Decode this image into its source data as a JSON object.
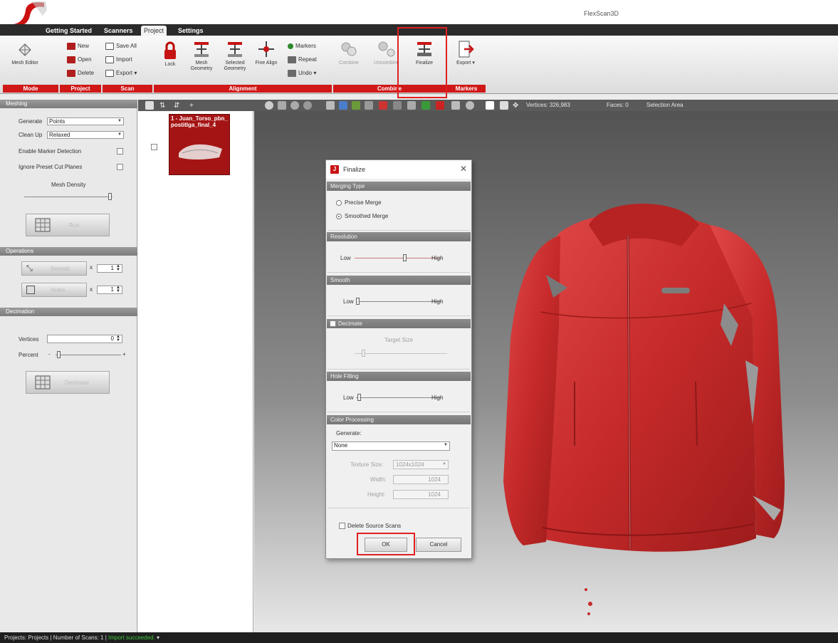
{
  "window": {
    "title": "FlexScan3D"
  },
  "tabs": [
    "Getting Started",
    "Scanners",
    "Project",
    "Settings"
  ],
  "active_tab": "Project",
  "ribbon": {
    "groups": {
      "mode": "Mode",
      "project": "Project",
      "scan": "Scan",
      "alignment": "Alignment",
      "combine": "Combine",
      "markers": "Markers"
    },
    "mesh_editor": "Mesh Editor",
    "new": "New",
    "open": "Open",
    "delete": "Delete",
    "save_all": "Save All",
    "import": "Import",
    "export_scan": "Export",
    "lock": "Lock",
    "mesh_geometry": "Mesh Geometry",
    "selected_geometry": "Selected Geometry",
    "fine_align": "Fine Align",
    "markers_btn": "Markers",
    "repeat": "Repeat",
    "undo": "Undo",
    "combine_btn": "Combine",
    "uncombine": "Uncombine",
    "finalize": "Finalize",
    "export_btn": "Export"
  },
  "left_panel": {
    "meshing": {
      "title": "Meshing",
      "generate_label": "Generate",
      "generate_value": "Points",
      "cleanup_label": "Clean Up",
      "cleanup_value": "Relaxed",
      "enable_marker": "Enable Marker Detection",
      "ignore_preset": "Ignore Preset Cut Planes",
      "mesh_density": "Mesh Density",
      "run": "Run"
    },
    "operations": {
      "title": "Operations",
      "op1": "Smooth",
      "op1_x": "x",
      "op1_count": "1",
      "op2": "Holes",
      "op2_x": "x",
      "op2_count": "1"
    },
    "decimation": {
      "title": "Decimation",
      "vertices_label": "Vertices",
      "vertices_value": "0",
      "percent_label": "Percent",
      "minus": "-",
      "plus": "+",
      "decimate": "Decimate"
    }
  },
  "scan_list": {
    "scan_name": "1 - Juan_Torso_pbn_postitlga_final_4"
  },
  "view_toolbar": {
    "vertices": "Vertices: 326,983",
    "faces": "Faces: 0",
    "selection": "Selection Area"
  },
  "dialog": {
    "title": "Finalize",
    "merging_type": "Merging Type",
    "precise_merge": "Precise Merge",
    "smoothed_merge": "Smoothed Merge",
    "resolution": "Resolution",
    "low": "Low",
    "high": "High",
    "smooth": "Smooth",
    "decimate": "Decimate",
    "target_size": "Target Size",
    "hole_filling": "Hole Filling",
    "color_processing": "Color Processing",
    "generate_label": "Generate:",
    "generate_value": "None",
    "texture_size_label": "Texture Size:",
    "texture_size_value": "1024x1024",
    "width_label": "Width:",
    "width_value": "1024",
    "height_label": "Height:",
    "height_value": "1024",
    "delete_source": "Delete Source Scans",
    "ok": "OK",
    "cancel": "Cancel"
  },
  "status": {
    "projects": "Projects: Projects",
    "num_scans": "Number of Scans: 1",
    "import_status": "Import succeeded."
  },
  "colors": {
    "accent": "#d01818",
    "model": "#c62a2a",
    "highlight": "#e02020"
  }
}
